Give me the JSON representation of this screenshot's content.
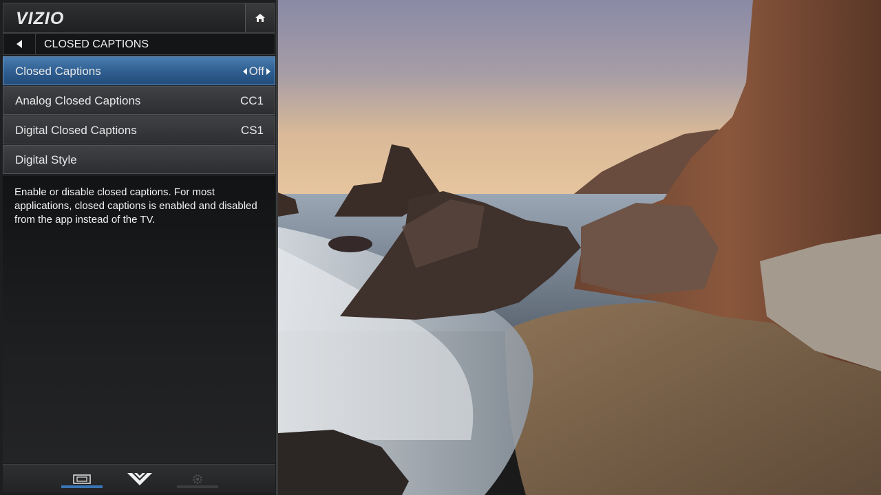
{
  "header": {
    "logo": "VIZIO"
  },
  "titlebar": {
    "title": "CLOSED CAPTIONS"
  },
  "menu": {
    "items": [
      {
        "label": "Closed Captions",
        "value": "Off"
      },
      {
        "label": "Analog Closed Captions",
        "value": "CC1"
      },
      {
        "label": "Digital Closed Captions",
        "value": "CS1"
      },
      {
        "label": "Digital Style",
        "value": ""
      }
    ]
  },
  "description": {
    "text": "Enable or disable closed captions.  For most applications, closed captions is enabled and disabled from the app instead of the TV."
  },
  "bottom_tabs": [
    {
      "icon": "input-screen-icon",
      "active": true
    },
    {
      "icon": "vizio-v-logo-icon",
      "active": false
    },
    {
      "icon": "gear-icon",
      "active": false
    }
  ],
  "colors": {
    "selected_item": "#2e5d8f",
    "active_tab_underline": "#3a74b4",
    "inactive_tab_underline": "#3b3c3e"
  }
}
